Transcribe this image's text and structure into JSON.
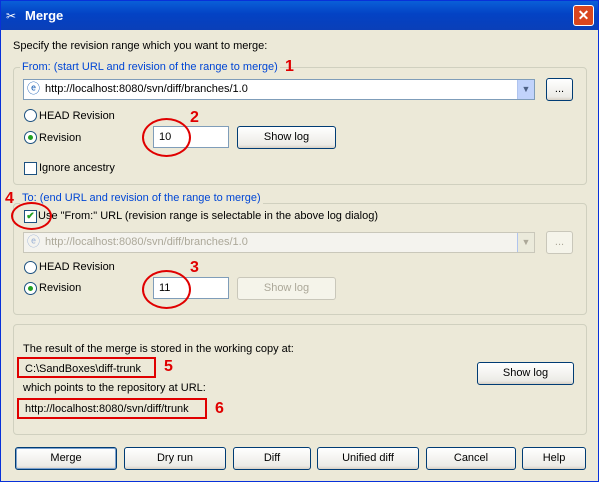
{
  "window": {
    "title": "Merge",
    "close_label": "✕"
  },
  "intro_text": "Specify the revision range which you want to merge:",
  "from_group": {
    "legend": "From: (start URL and revision of the range to merge)",
    "url": "http://localhost:8080/svn/diff/branches/1.0",
    "browse_label": "...",
    "head_revision_label": "HEAD Revision",
    "revision_label": "Revision",
    "revision_value": "10",
    "show_log_label": "Show log",
    "ignore_ancestry_label": "Ignore ancestry"
  },
  "to_group": {
    "legend": "To: (end URL and revision of the range to merge)",
    "use_from_label": "Use \"From:\" URL (revision range is selectable in the above log dialog)",
    "use_from_checked": true,
    "url": "http://localhost:8080/svn/diff/branches/1.0",
    "browse_label": "...",
    "head_revision_label": "HEAD Revision",
    "revision_label": "Revision",
    "revision_value": "11",
    "show_log_label": "Show log"
  },
  "result_group": {
    "stored_text": "The result of the merge is stored in the working copy at:",
    "working_copy_path": "C:\\SandBoxes\\diff-trunk",
    "points_text": "which points to the repository at URL:",
    "repo_url": "http://localhost:8080/svn/diff/trunk",
    "show_log_label": "Show log"
  },
  "buttons": {
    "merge": "Merge",
    "dry_run": "Dry run",
    "diff": "Diff",
    "unified_diff": "Unified diff",
    "cancel": "Cancel",
    "help": "Help"
  },
  "annotations": {
    "n1": "1",
    "n2": "2",
    "n3": "3",
    "n4": "4",
    "n5": "5",
    "n6": "6"
  },
  "colors": {
    "annotation": "#e00000",
    "legend_text": "#0046d5",
    "titlebar": "#0a5fd8"
  }
}
